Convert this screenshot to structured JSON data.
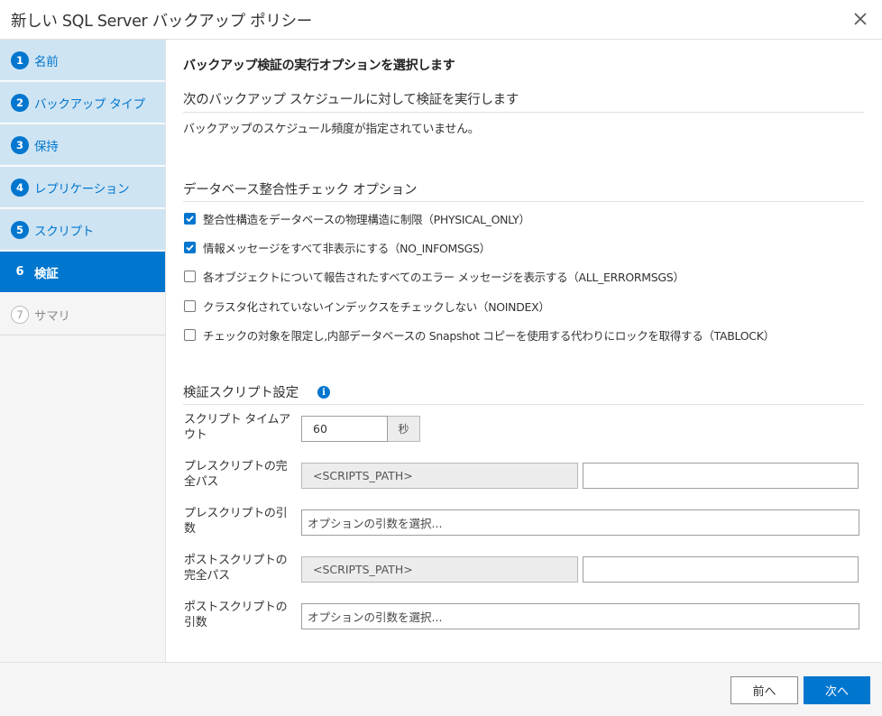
{
  "window": {
    "title": "新しい SQL Server バックアップ ポリシー"
  },
  "steps": [
    {
      "num": "1",
      "label": "名前",
      "state": "done"
    },
    {
      "num": "2",
      "label": "バックアップ タイプ",
      "state": "done"
    },
    {
      "num": "3",
      "label": "保持",
      "state": "done"
    },
    {
      "num": "4",
      "label": "レプリケーション",
      "state": "done"
    },
    {
      "num": "5",
      "label": "スクリプト",
      "state": "done"
    },
    {
      "num": "6",
      "label": "検証",
      "state": "active"
    },
    {
      "num": "7",
      "label": "サマリ",
      "state": "disabled"
    }
  ],
  "main": {
    "heading": "バックアップ検証の実行オプションを選択します",
    "schedule_section": {
      "title": "次のバックアップ スケジュールに対して検証を実行します",
      "message": "バックアップのスケジュール頻度が指定されていません。"
    },
    "dbcc_section": {
      "title": "データベース整合性チェック オプション",
      "options": [
        {
          "label": "整合性構造をデータベースの物理構造に制限（PHYSICAL_ONLY）",
          "checked": true
        },
        {
          "label": "情報メッセージをすべて非表示にする（NO_INFOMSGS）",
          "checked": true
        },
        {
          "label": "各オブジェクトについて報告されたすべてのエラー メッセージを表示する（ALL_ERRORMSGS）",
          "checked": false
        },
        {
          "label": "クラスタ化されていないインデックスをチェックしない（NOINDEX）",
          "checked": false
        },
        {
          "label": "チェックの対象を限定し,内部データベースの Snapshot コピーを使用する代わりにロックを取得する（TABLOCK）",
          "checked": false
        }
      ]
    },
    "script_section": {
      "title": "検証スクリプト設定",
      "timeout_label": "スクリプト タイムアウト",
      "timeout_value": "60",
      "timeout_unit": "秒",
      "prescript_path_label": "プレスクリプトの完全パス",
      "prescript_path_prefix": "<SCRIPTS_PATH>",
      "prescript_path_value": "",
      "prescript_args_label": "プレスクリプトの引数",
      "prescript_args_placeholder": "オプションの引数を選択...",
      "postscript_path_label": "ポストスクリプトの完全パス",
      "postscript_path_prefix": "<SCRIPTS_PATH>",
      "postscript_path_value": "",
      "postscript_args_label": "ポストスクリプトの引数",
      "postscript_args_placeholder": "オプションの引数を選択..."
    }
  },
  "footer": {
    "prev_label": "前へ",
    "next_label": "次へ"
  },
  "colors": {
    "accent": "#0076ce",
    "sidebar_done": "#cfe4f3"
  }
}
